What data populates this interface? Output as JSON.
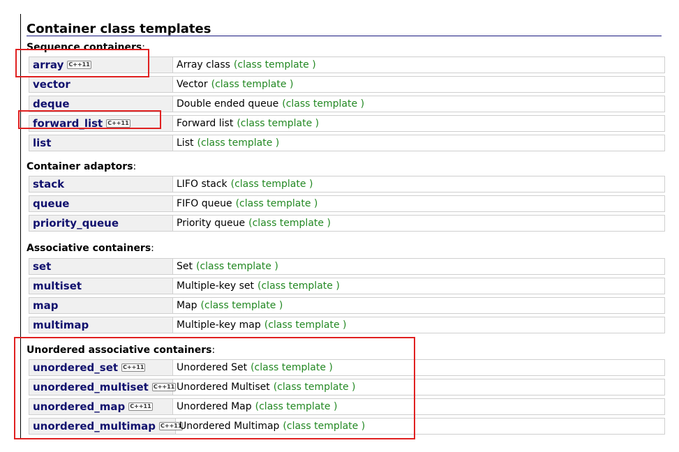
{
  "page_title": "Container class templates",
  "badge_text": "C++11",
  "highlight_color": "#e02020",
  "link_color": "#11116e",
  "kind_color": "#228822",
  "groups": [
    {
      "label": "Sequence containers",
      "rows": [
        {
          "name": "array",
          "desc": "Array class",
          "kind": "(class template )",
          "cpp11": true
        },
        {
          "name": "vector",
          "desc": "Vector",
          "kind": "(class template )",
          "cpp11": false
        },
        {
          "name": "deque",
          "desc": "Double ended queue",
          "kind": "(class template )",
          "cpp11": false
        },
        {
          "name": "forward_list",
          "desc": "Forward list",
          "kind": "(class template )",
          "cpp11": true
        },
        {
          "name": "list",
          "desc": "List",
          "kind": "(class template )",
          "cpp11": false
        }
      ]
    },
    {
      "label": "Container adaptors",
      "rows": [
        {
          "name": "stack",
          "desc": "LIFO stack",
          "kind": "(class template )",
          "cpp11": false
        },
        {
          "name": "queue",
          "desc": "FIFO queue",
          "kind": "(class template )",
          "cpp11": false
        },
        {
          "name": "priority_queue",
          "desc": "Priority queue",
          "kind": "(class template )",
          "cpp11": false
        }
      ]
    },
    {
      "label": "Associative containers",
      "rows": [
        {
          "name": "set",
          "desc": "Set",
          "kind": "(class template )",
          "cpp11": false
        },
        {
          "name": "multiset",
          "desc": "Multiple-key set",
          "kind": "(class template )",
          "cpp11": false
        },
        {
          "name": "map",
          "desc": "Map",
          "kind": "(class template )",
          "cpp11": false
        },
        {
          "name": "multimap",
          "desc": "Multiple-key map",
          "kind": "(class template )",
          "cpp11": false
        }
      ]
    },
    {
      "label": "Unordered associative containers",
      "rows": [
        {
          "name": "unordered_set",
          "desc": "Unordered Set",
          "kind": "(class template )",
          "cpp11": true
        },
        {
          "name": "unordered_multiset",
          "desc": "Unordered Multiset",
          "kind": "(class template )",
          "cpp11": true
        },
        {
          "name": "unordered_map",
          "desc": "Unordered Map",
          "kind": "(class template )",
          "cpp11": true
        },
        {
          "name": "unordered_multimap",
          "desc": "Unordered Multimap",
          "kind": "(class template )",
          "cpp11": true
        }
      ]
    }
  ]
}
